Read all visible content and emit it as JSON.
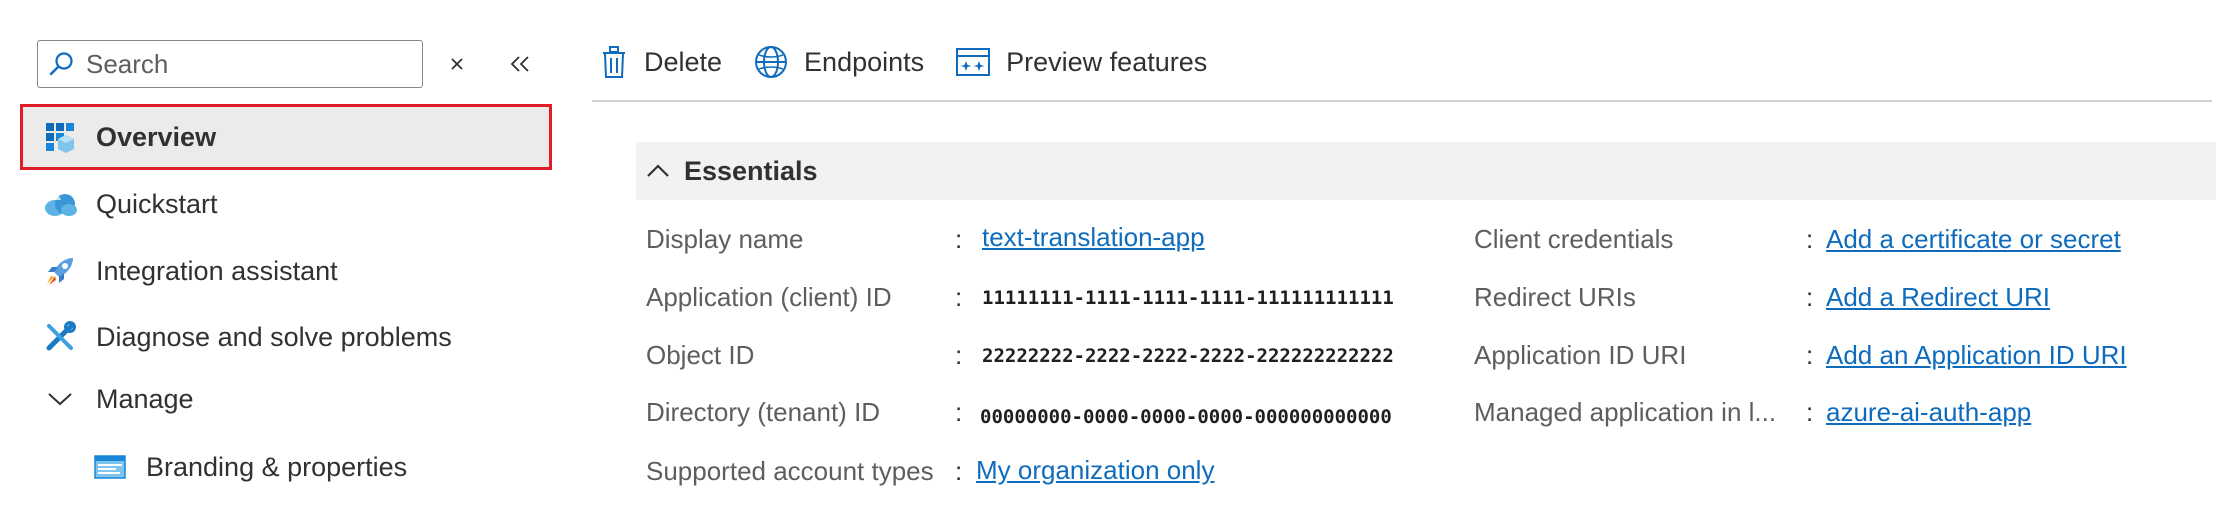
{
  "sidebar": {
    "search_placeholder": "Search",
    "items": [
      {
        "label": "Overview",
        "icon": "overview-grid-icon",
        "selected": true
      },
      {
        "label": "Quickstart",
        "icon": "cloud-quickstart-icon"
      },
      {
        "label": "Integration assistant",
        "icon": "rocket-icon"
      },
      {
        "label": "Diagnose and solve problems",
        "icon": "wrench-screwdriver-icon"
      },
      {
        "label": "Manage",
        "icon": "chevron-down-icon"
      },
      {
        "label": "Branding & properties",
        "icon": "branding-window-icon"
      }
    ]
  },
  "toolbar": {
    "delete_label": "Delete",
    "endpoints_label": "Endpoints",
    "preview_label": "Preview features"
  },
  "essentials": {
    "title": "Essentials",
    "left": [
      {
        "label": "Display name",
        "value": "text-translation-app",
        "type": "link"
      },
      {
        "label": "Application (client) ID",
        "value": "11111111-1111-1111-1111-111111111111",
        "type": "mono"
      },
      {
        "label": "Object ID",
        "value": "22222222-2222-2222-2222-222222222222",
        "type": "mono"
      },
      {
        "label": "Directory (tenant) ID",
        "value": "00000000-0000-0000-0000-000000000000",
        "type": "mono"
      },
      {
        "label": "Supported account types",
        "value": "My organization only",
        "type": "link"
      }
    ],
    "right": [
      {
        "label": "Client credentials",
        "value": "Add a certificate or secret",
        "type": "link"
      },
      {
        "label": "Redirect URIs",
        "value": "Add a Redirect URI",
        "type": "link"
      },
      {
        "label": "Application ID URI",
        "value": "Add an Application ID URI",
        "type": "link"
      },
      {
        "label": "Managed application in l...",
        "value": "azure-ai-auth-app",
        "type": "link"
      }
    ],
    "separator": ":"
  },
  "colors": {
    "accent": "#0f6cbd",
    "selected_border": "#e11d2a",
    "selected_bg": "#edebe9"
  }
}
